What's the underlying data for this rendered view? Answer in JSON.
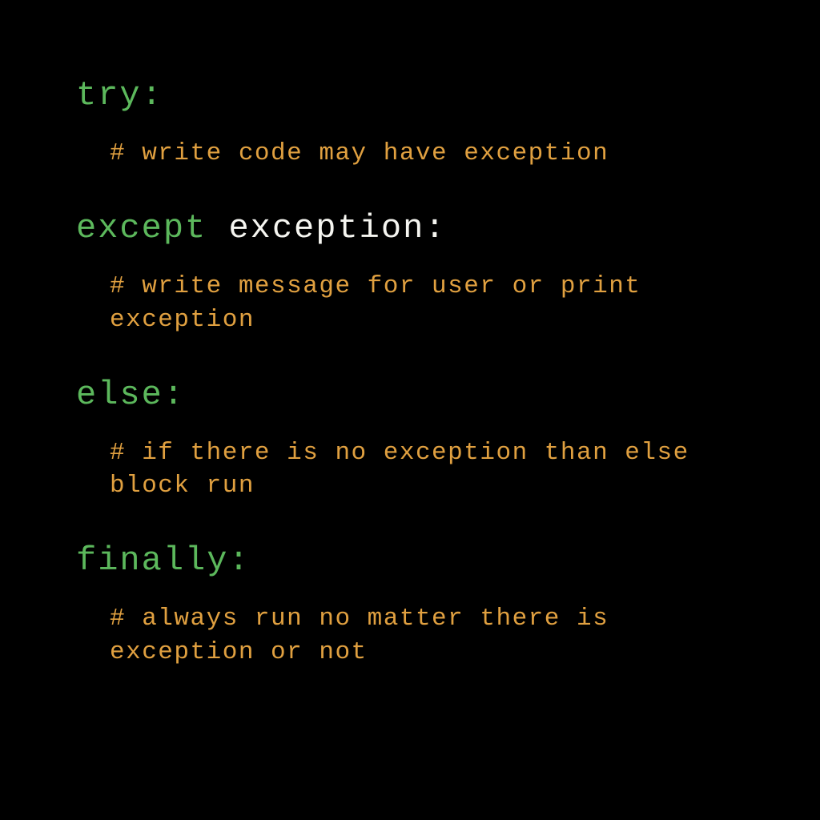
{
  "blocks": {
    "try": {
      "keyword": "try:",
      "comment": "# write code may have exception"
    },
    "except": {
      "keyword": "except",
      "identifier": " exception:",
      "comment": "# write message for user or print exception"
    },
    "else": {
      "keyword": "else:",
      "comment": "# if there is no exception than else block run"
    },
    "finally": {
      "keyword": "finally:",
      "comment": "# always run no matter there is exception or not"
    }
  },
  "colors": {
    "background": "#000000",
    "keyword": "#5cb85c",
    "identifier": "#f5f5f0",
    "comment": "#e0a040"
  }
}
